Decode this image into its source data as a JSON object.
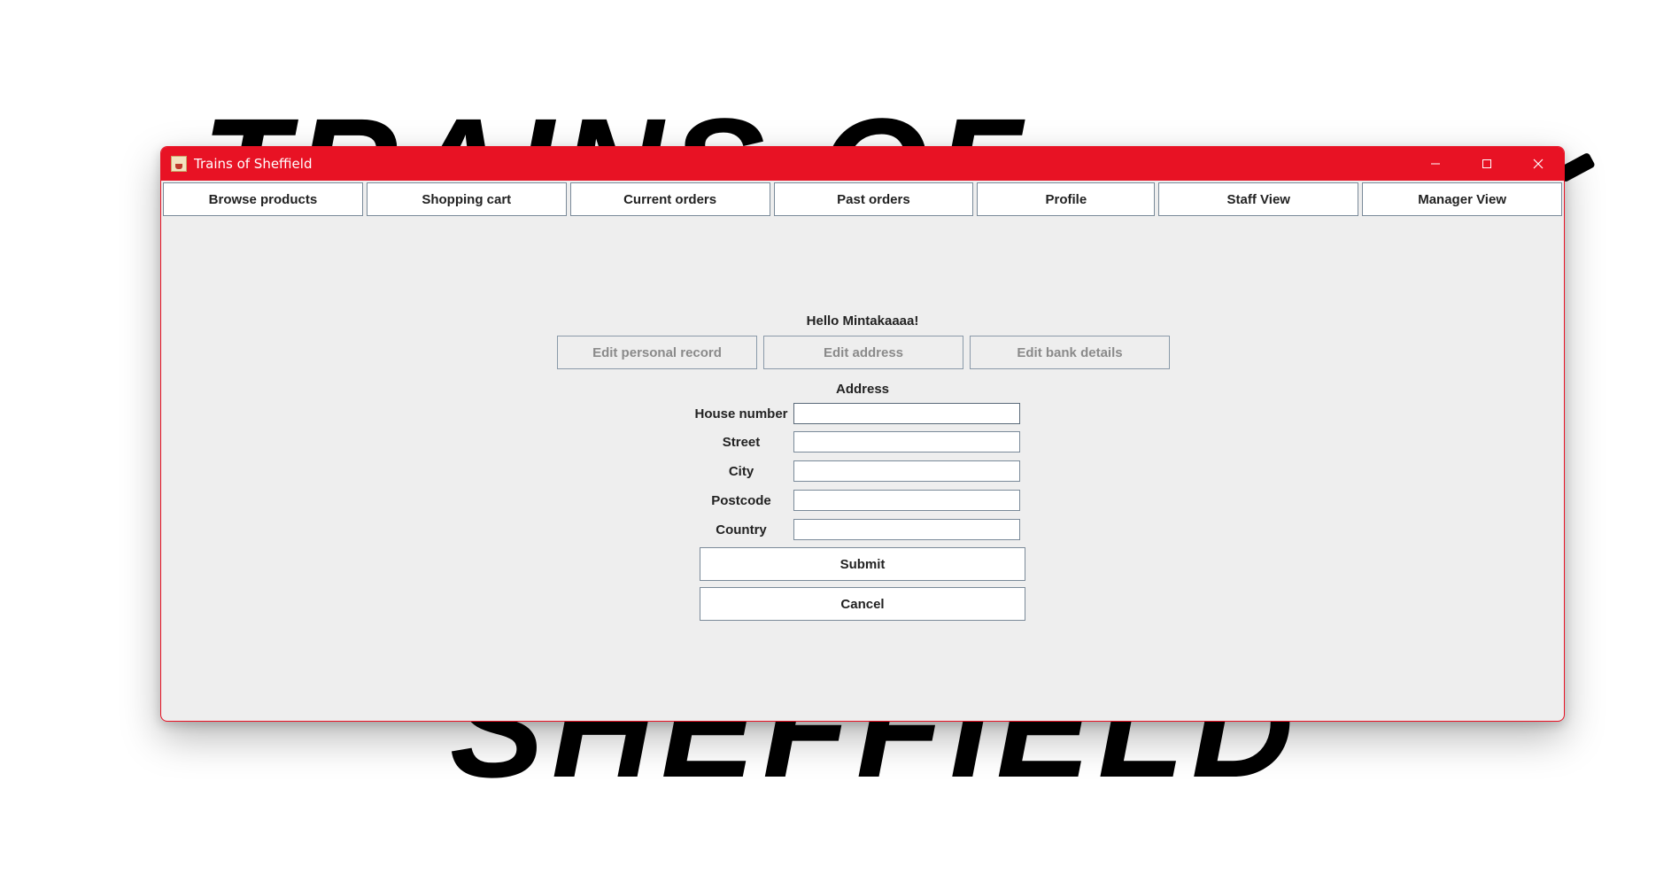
{
  "background": {
    "top_text": "TRAINS OF",
    "bottom_text": "SHEFFIELD"
  },
  "window": {
    "title": "Trains of Sheffield",
    "accent_color": "#e81224",
    "controls": {
      "minimize": "minimize-icon",
      "maximize": "maximize-icon",
      "close": "close-icon"
    }
  },
  "nav": {
    "items": [
      {
        "label": "Browse products"
      },
      {
        "label": "Shopping cart"
      },
      {
        "label": "Current orders"
      },
      {
        "label": "Past orders"
      },
      {
        "label": "Profile"
      },
      {
        "label": "Staff View"
      },
      {
        "label": "Manager View"
      }
    ]
  },
  "profile": {
    "greeting": "Hello Mintakaaaa!",
    "edit_buttons": [
      {
        "label": "Edit personal record"
      },
      {
        "label": "Edit address"
      },
      {
        "label": "Edit bank details"
      }
    ],
    "section_title": "Address",
    "fields": [
      {
        "label": "House number",
        "value": ""
      },
      {
        "label": "Street",
        "value": ""
      },
      {
        "label": "City",
        "value": ""
      },
      {
        "label": "Postcode",
        "value": ""
      },
      {
        "label": "Country",
        "value": ""
      }
    ],
    "submit_label": "Submit",
    "cancel_label": "Cancel"
  }
}
